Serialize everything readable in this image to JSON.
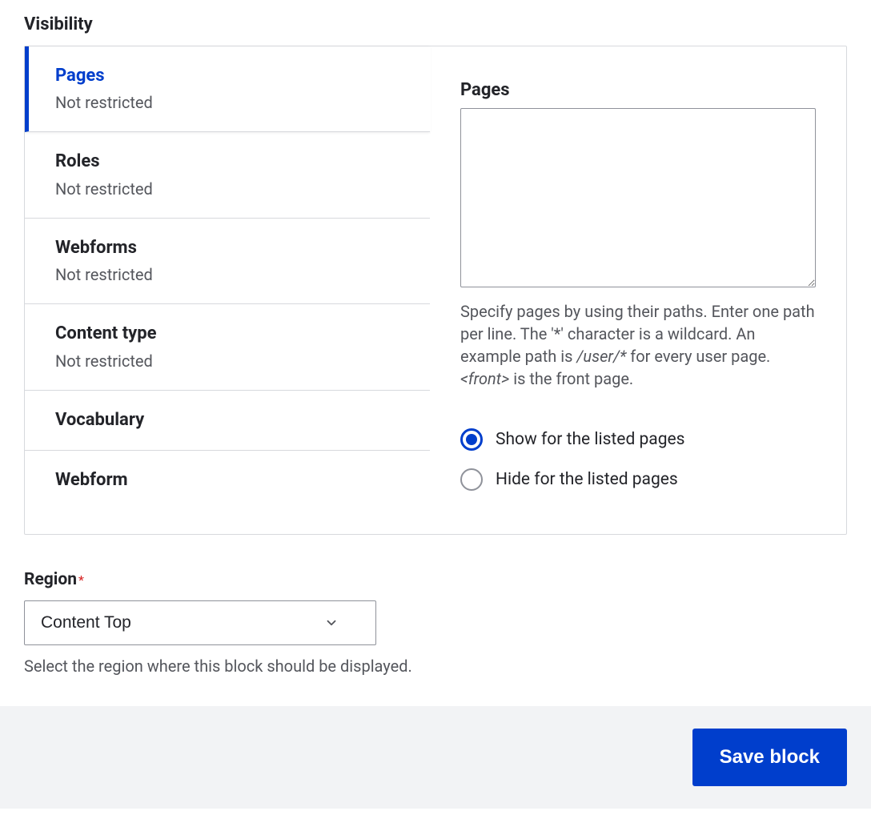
{
  "section_title": "Visibility",
  "tabs": [
    {
      "title": "Pages",
      "sub": "Not restricted"
    },
    {
      "title": "Roles",
      "sub": "Not restricted"
    },
    {
      "title": "Webforms",
      "sub": "Not restricted"
    },
    {
      "title": "Content type",
      "sub": "Not restricted"
    },
    {
      "title": "Vocabulary",
      "sub": ""
    },
    {
      "title": "Webform",
      "sub": ""
    }
  ],
  "panel": {
    "label": "Pages",
    "textarea_value": "",
    "help_pre": "Specify pages by using their paths. Enter one path per line. The '*' character is a wildcard. An example path is ",
    "help_em1": "/user/*",
    "help_mid": " for every user page. ",
    "help_em2": "<front>",
    "help_post": " is the front page.",
    "radios": [
      {
        "label": "Show for the listed pages",
        "checked": true
      },
      {
        "label": "Hide for the listed pages",
        "checked": false
      }
    ]
  },
  "region": {
    "label": "Region",
    "selected": "Content Top",
    "help": "Select the region where this block should be displayed."
  },
  "actions": {
    "save": "Save block"
  }
}
